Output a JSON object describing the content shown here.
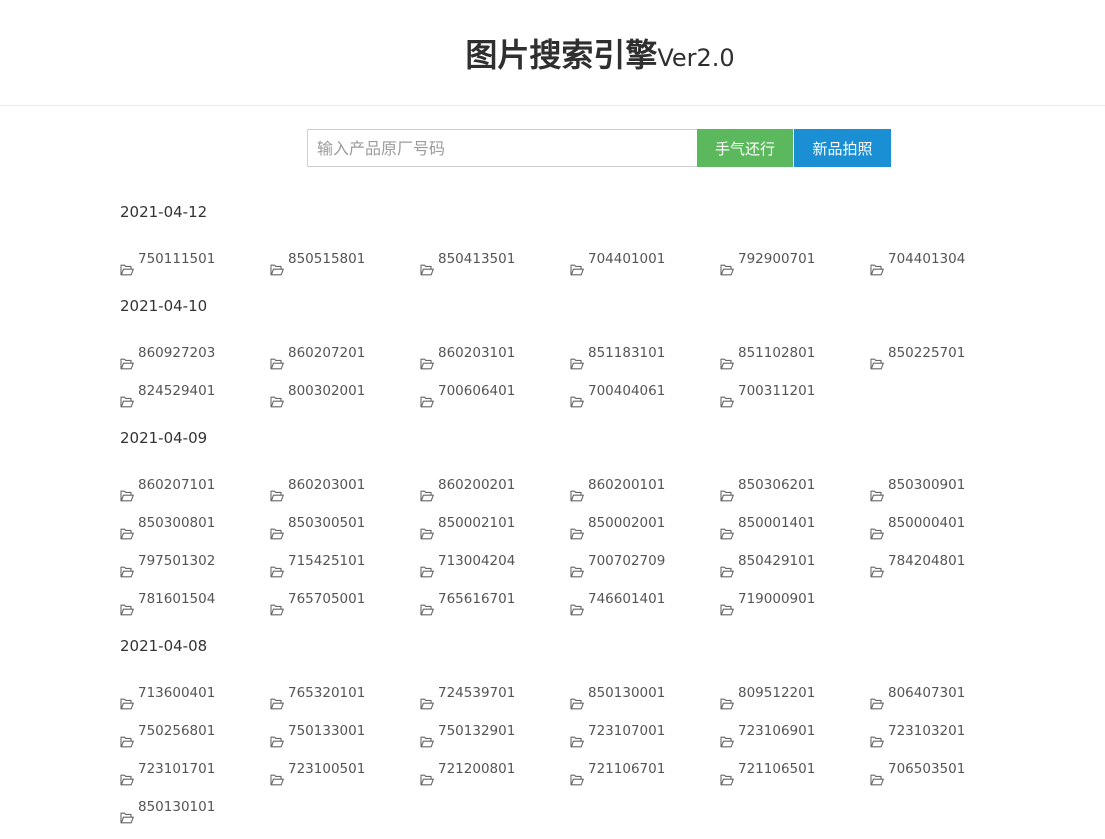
{
  "header": {
    "title_main": "图片搜索引擎",
    "title_version": "Ver2.0"
  },
  "search": {
    "placeholder": "输入产品原厂号码",
    "value": "",
    "button_primary": "手气还行",
    "button_secondary": "新品拍照"
  },
  "icons": {
    "folder": "folder-open-icon"
  },
  "colors": {
    "green_button": "#5cb85c",
    "blue_button": "#1a8fd4"
  },
  "groups": [
    {
      "date": "2021-04-12",
      "items": [
        "750111501",
        "850515801",
        "850413501",
        "704401001",
        "792900701",
        "704401304"
      ]
    },
    {
      "date": "2021-04-10",
      "items": [
        "860927203",
        "860207201",
        "860203101",
        "851183101",
        "851102801",
        "850225701",
        "824529401",
        "800302001",
        "700606401",
        "700404061",
        "700311201"
      ]
    },
    {
      "date": "2021-04-09",
      "items": [
        "860207101",
        "860203001",
        "860200201",
        "860200101",
        "850306201",
        "850300901",
        "850300801",
        "850300501",
        "850002101",
        "850002001",
        "850001401",
        "850000401",
        "797501302",
        "715425101",
        "713004204",
        "700702709",
        "850429101",
        "784204801",
        "781601504",
        "765705001",
        "765616701",
        "746601401",
        "719000901"
      ]
    },
    {
      "date": "2021-04-08",
      "items": [
        "713600401",
        "765320101",
        "724539701",
        "850130001",
        "809512201",
        "806407301",
        "750256801",
        "750133001",
        "750132901",
        "723107001",
        "723106901",
        "723103201",
        "723101701",
        "723100501",
        "721200801",
        "721106701",
        "721106501",
        "706503501",
        "850130101"
      ]
    }
  ]
}
